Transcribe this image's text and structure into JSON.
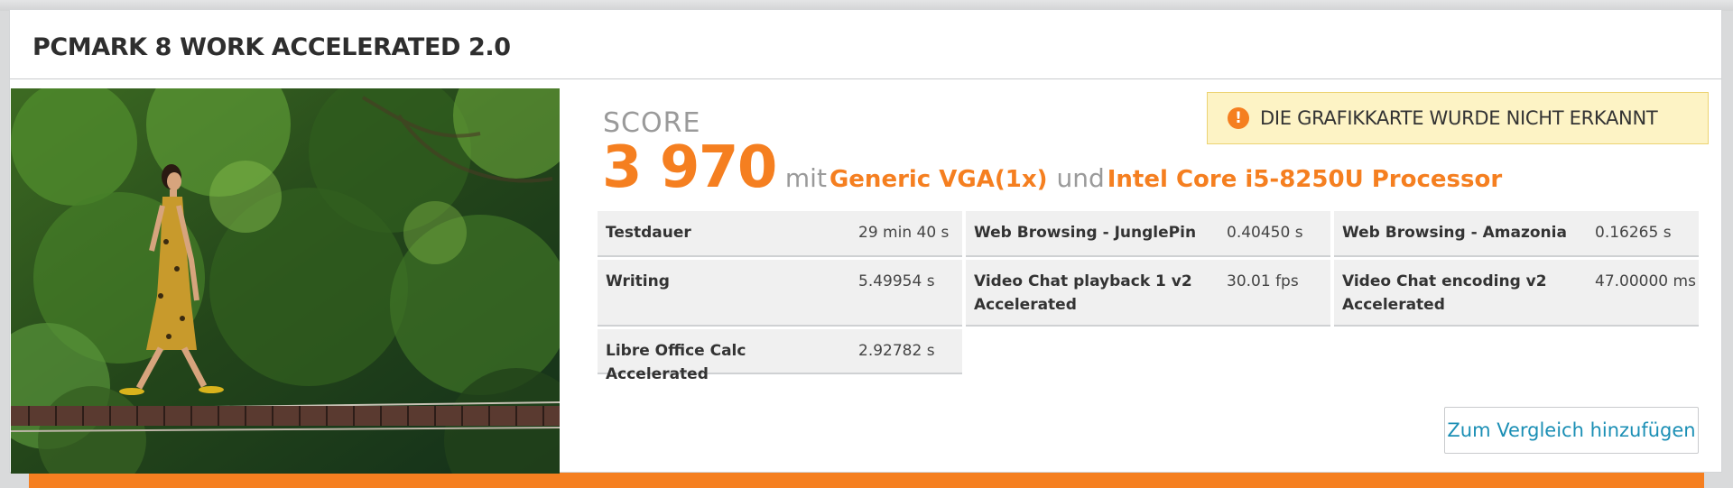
{
  "header": {
    "title": "PCMARK 8 WORK ACCELERATED 2.0"
  },
  "score": {
    "label": "SCORE",
    "value": "3 970",
    "connector_with": "mit",
    "gpu": "Generic VGA(1x)",
    "connector_and": "und",
    "cpu": "Intel Core i5-8250U Processor"
  },
  "alert": {
    "icon": "exclamation-icon",
    "text": "DIE GRAFIKKARTE WURDE NICHT ERKANNT"
  },
  "results": [
    {
      "name": "Testdauer",
      "value": "29 min 40 s"
    },
    {
      "name": "Web Browsing - JunglePin",
      "value": "0.40450 s"
    },
    {
      "name": "Web Browsing - Amazonia",
      "value": "0.16265 s"
    },
    {
      "name": "Writing",
      "value": "5.49954 s"
    },
    {
      "name": "Video Chat playback 1 v2 Accelerated",
      "value": "30.01 fps"
    },
    {
      "name": "Video Chat encoding v2 Accelerated",
      "value": "47.00000 ms"
    },
    {
      "name": "Libre Office Calc Accelerated",
      "value": "2.92782 s"
    }
  ],
  "actions": {
    "compare_label": "Zum Vergleich hinzufügen"
  },
  "colors": {
    "accent": "#f57f20",
    "link": "#1b8fb5",
    "alert_background": "#fdf3c5"
  }
}
